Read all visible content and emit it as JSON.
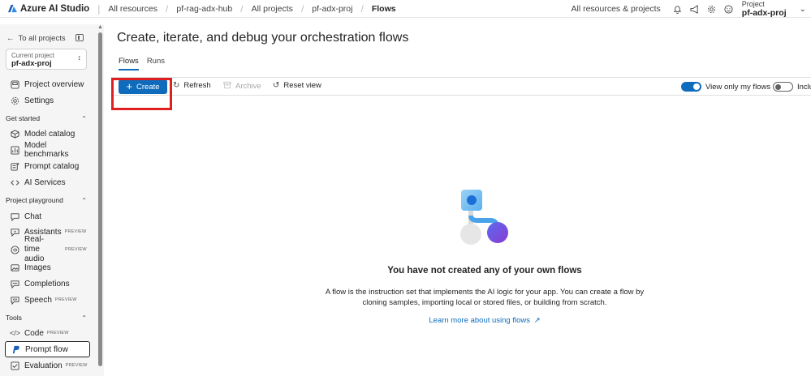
{
  "topbar": {
    "brand": "Azure AI Studio",
    "breadcrumbs": [
      "All resources",
      "pf-rag-adx-hub",
      "All projects",
      "pf-adx-proj",
      "Flows"
    ],
    "all_resources_label": "All resources & projects",
    "project_label": "Project",
    "project_name": "pf-adx-proj"
  },
  "sidebar": {
    "back_label": "To all projects",
    "current_project_label": "Current project",
    "current_project_name": "pf-adx-proj",
    "items_top": [
      {
        "label": "Project overview"
      },
      {
        "label": "Settings"
      }
    ],
    "section_get_started": "Get started",
    "items_get_started": [
      {
        "label": "Model catalog"
      },
      {
        "label": "Model benchmarks"
      },
      {
        "label": "Prompt catalog"
      },
      {
        "label": "AI Services"
      }
    ],
    "section_playground": "Project playground",
    "items_playground": [
      {
        "label": "Chat",
        "badge": ""
      },
      {
        "label": "Assistants",
        "badge": "PREVIEW"
      },
      {
        "label": "Real-time audio",
        "badge": "PREVIEW"
      },
      {
        "label": "Images",
        "badge": ""
      },
      {
        "label": "Completions",
        "badge": ""
      },
      {
        "label": "Speech",
        "badge": "PREVIEW"
      }
    ],
    "section_tools": "Tools",
    "items_tools": [
      {
        "label": "Code",
        "badge": "PREVIEW"
      },
      {
        "label": "Prompt flow",
        "badge": ""
      },
      {
        "label": "Evaluation",
        "badge": "PREVIEW"
      }
    ]
  },
  "main": {
    "title": "Create, iterate, and debug your orchestration flows",
    "tabs": [
      {
        "label": "Flows"
      },
      {
        "label": "Runs"
      }
    ],
    "toolbar": {
      "create": "Create",
      "refresh": "Refresh",
      "archive": "Archive",
      "reset_view": "Reset view",
      "view_only_my_flows": "View only my flows",
      "include": "Inclu"
    },
    "empty": {
      "title": "You have not created any of your own flows",
      "desc_line1": "A flow is the instruction set that implements the AI logic for your app. You can create a flow by",
      "desc_line2": "cloning samples, importing local or stored files, or building from scratch.",
      "link": "Learn more about using flows"
    }
  },
  "colors": {
    "accent": "#0f6cbd",
    "highlight": "#e02020",
    "illus_purple": "#7b4fd6",
    "illus_blue": "#1b8fe6"
  }
}
